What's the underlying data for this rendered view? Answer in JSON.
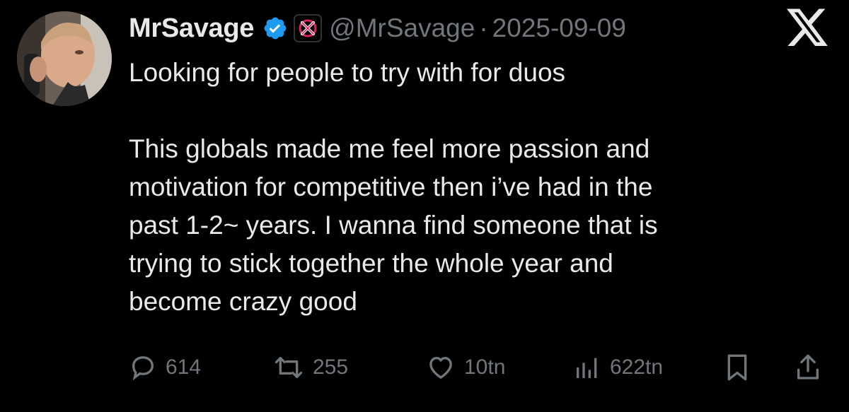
{
  "author": {
    "display_name": "MrSavage",
    "handle": "@MrSavage",
    "separator": "·",
    "date": "2025-09-09",
    "verified_icon": "verified-badge-icon",
    "affiliation_icon": "team-affiliation-icon"
  },
  "tweet": {
    "lines_paragraph_1": [
      "Looking for people to try with for duos"
    ],
    "lines_paragraph_2": [
      "This globals made me feel more passion and",
      "motivation for competitive then i’ve had in the",
      "past 1-2~ years. I wanna find someone that is",
      "trying to stick together the whole year and",
      "become crazy good"
    ]
  },
  "actions": {
    "replies": "614",
    "reposts": "255",
    "likes": "10tn",
    "views": "622tn"
  },
  "colors": {
    "background": "#000000",
    "text": "#e7e9ea",
    "muted": "#71767b",
    "verified": "#1d9bf0",
    "affiliation_accent": "#e0245e"
  }
}
